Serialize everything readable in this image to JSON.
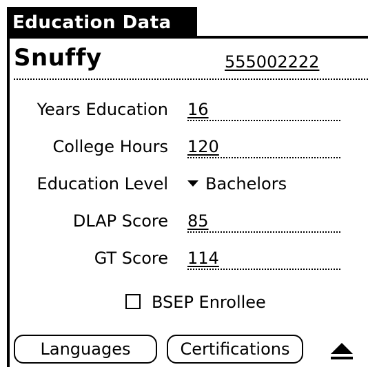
{
  "title": "Education Data",
  "record": {
    "name": "Snuffy",
    "id": "555002222"
  },
  "fields": {
    "years_education": {
      "label": "Years Education",
      "value": "16"
    },
    "college_hours": {
      "label": "College Hours",
      "value": "120"
    },
    "education_level": {
      "label": "Education Level",
      "value": "Bachelors"
    },
    "dlap_score": {
      "label": "DLAP Score",
      "value": "85"
    },
    "gt_score": {
      "label": "GT Score",
      "value": "114"
    }
  },
  "checkbox": {
    "label": "BSEP Enrollee",
    "checked": false
  },
  "buttons": {
    "languages": "Languages",
    "certifications": "Certifications"
  },
  "icons": {
    "dropdown": "triangle-down-icon",
    "scroll": "up-arrow-icon"
  },
  "colors": {
    "foreground": "#000000",
    "background": "#ffffff"
  }
}
